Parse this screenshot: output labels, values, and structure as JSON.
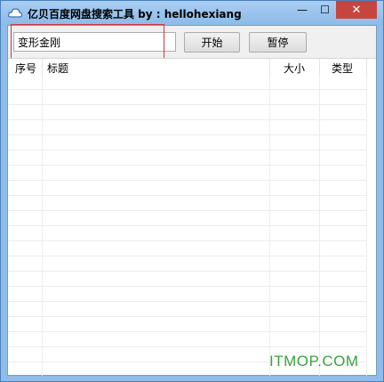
{
  "window": {
    "title": "亿贝百度网盘搜索工具 by : hellohexiang",
    "minimize_label": "—",
    "maximize_label": "☐",
    "close_label": "✕"
  },
  "search": {
    "value": "变形金刚"
  },
  "buttons": {
    "start": "开始",
    "pause": "暂停"
  },
  "table": {
    "columns": [
      "序号",
      "标题",
      "大小",
      "类型"
    ]
  },
  "watermark": "ITMOP.COM",
  "colors": {
    "close_button": "#c7453f",
    "highlight_box": "#d8323b",
    "watermark": "#3aa23e"
  }
}
